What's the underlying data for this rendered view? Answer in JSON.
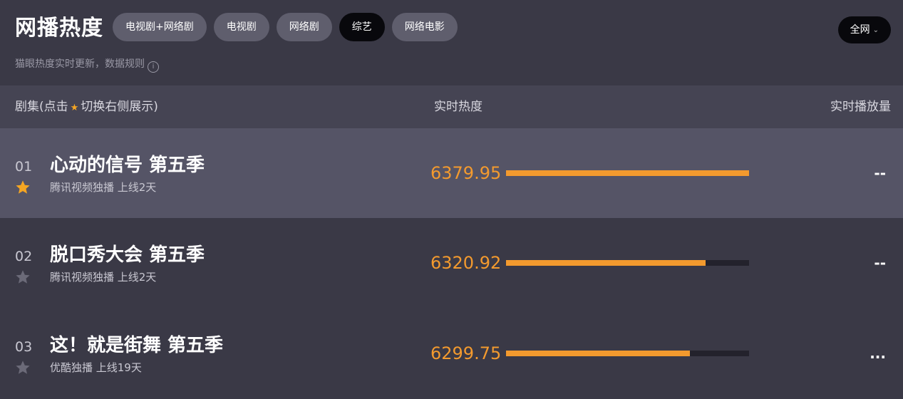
{
  "header": {
    "title": "网播热度",
    "tabs": [
      "电视剧+网络剧",
      "电视剧",
      "网络剧",
      "综艺",
      "网络电影"
    ],
    "active_tab": "综艺",
    "scope_label": "全网",
    "scope_chevron": "⌄",
    "subtitle": "猫眼热度实时更新，数据规则",
    "info_glyph": "i"
  },
  "columns": {
    "title_prefix": "剧集(点击",
    "title_star": "★",
    "title_suffix": "切换右侧展示)",
    "heat": "实时热度",
    "plays": "实时播放量"
  },
  "rows": [
    {
      "rank": "01",
      "name": "心动的信号 第五季",
      "meta": "腾讯视频独播  上线2天",
      "heat": "6379.95",
      "heat_value": 6379.95,
      "plays": "--",
      "starred": true,
      "selected": true
    },
    {
      "rank": "02",
      "name": "脱口秀大会 第五季",
      "meta": "腾讯视频独播  上线2天",
      "heat": "6320.92",
      "heat_value": 6320.92,
      "plays": "--",
      "starred": false,
      "selected": false
    },
    {
      "rank": "03",
      "name": "这！就是街舞 第五季",
      "meta": "优酷独播  上线19天",
      "heat": "6299.75",
      "heat_value": 6299.75,
      "plays": "...",
      "starred": false,
      "selected": false
    }
  ],
  "colors": {
    "accent": "#f39a2e",
    "star_active": "#f5a623",
    "star_inactive": "#6b6a78"
  },
  "icons": {
    "star": "star-icon",
    "info": "info-icon",
    "chevron": "chevron-down-icon"
  }
}
